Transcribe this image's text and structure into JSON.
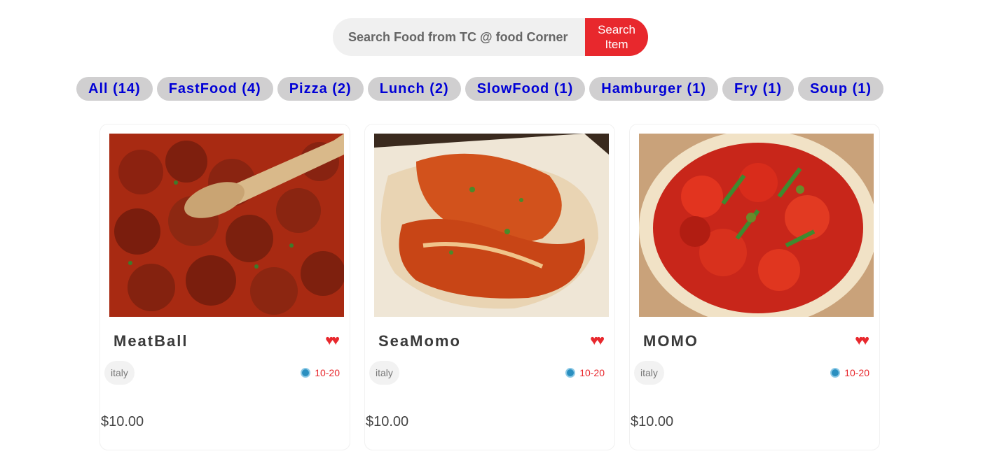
{
  "search": {
    "placeholder": "Search Food from TC @ food Corner",
    "button_label": "Search Item"
  },
  "filters": [
    {
      "label": "All (14)"
    },
    {
      "label": "FastFood (4)"
    },
    {
      "label": "Pizza (2)"
    },
    {
      "label": "Lunch (2)"
    },
    {
      "label": "SlowFood (1)"
    },
    {
      "label": "Hamburger (1)"
    },
    {
      "label": "Fry (1)"
    },
    {
      "label": "Soup (1)"
    }
  ],
  "items": [
    {
      "name": "MeatBall",
      "favorite": "♥♥",
      "origin": "italy",
      "time": "10-20",
      "price": "$10.00",
      "image": "meatball-photo"
    },
    {
      "name": "SeaMomo",
      "favorite": "♥♥",
      "origin": "italy",
      "time": "10-20",
      "price": "$10.00",
      "image": "seamomo-photo"
    },
    {
      "name": "MOMO",
      "favorite": "♥♥",
      "origin": "italy",
      "time": "10-20",
      "price": "$10.00",
      "image": "momo-photo"
    }
  ],
  "colors": {
    "accent": "#e8282d",
    "chip_bg": "#d0cfd0",
    "chip_text": "#0000d6",
    "search_bg": "#f0f0f0"
  }
}
